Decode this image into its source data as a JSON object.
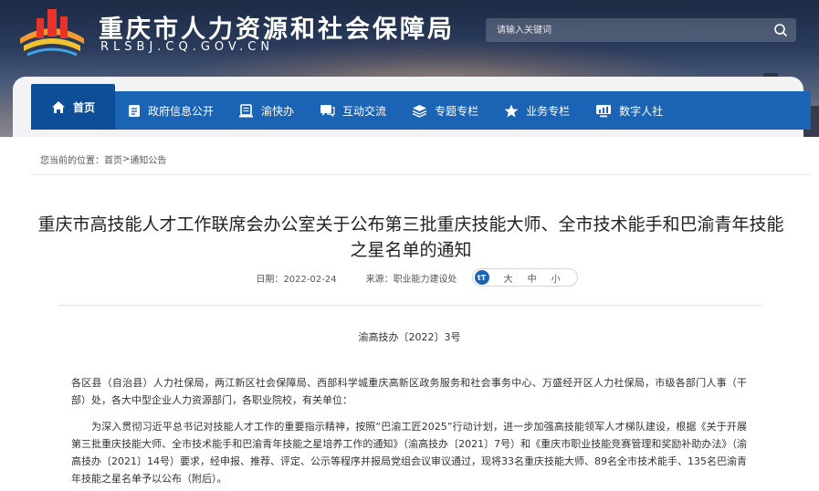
{
  "header": {
    "site_title": "重庆市人力资源和社会保障局",
    "site_subtitle": "RLSBJ.CQ.GOV.CN",
    "search_placeholder": "请输入关键词"
  },
  "nav": {
    "items": [
      {
        "label": "首页",
        "icon": "home-icon"
      },
      {
        "label": "政府信息公开",
        "icon": "document-icon"
      },
      {
        "label": "渝快办",
        "icon": "tablet-icon"
      },
      {
        "label": "互动交流",
        "icon": "chat-icon"
      },
      {
        "label": "专题专栏",
        "icon": "layers-icon"
      },
      {
        "label": "业务专栏",
        "icon": "star-icon"
      },
      {
        "label": "数字人社",
        "icon": "monitor-chart-icon"
      }
    ]
  },
  "breadcrumb": {
    "prefix": "您当前的位置：",
    "home": "首页",
    "separator": ">",
    "current": "通知公告"
  },
  "article": {
    "title": "重庆市高技能人才工作联席会办公室关于公布第三批重庆技能大师、全市技术能手和巴渝青年技能之星名单的通知",
    "date_label": "日期：",
    "date": "2022-02-24",
    "source_label": "来源：",
    "source": "职业能力建设处",
    "font_size_icon_text": "tT",
    "font_large": "大",
    "font_medium": "中",
    "font_small": "小",
    "doc_number": "渝高技办〔2022〕3号",
    "paragraph_1": "各区县（自治县）人力社保局，两江新区社会保障局、西部科学城重庆高新区政务服务和社会事务中心、万盛经开区人力社保局，市级各部门人事（干部）处，各大中型企业人力资源部门，各职业院校，有关单位：",
    "paragraph_2": "为深入贯彻习近平总书记对技能人才工作的重要指示精神，按照“巴渝工匠2025”行动计划，进一步加强高技能领军人才梯队建设，根据《关于开展第三批重庆技能大师、全市技术能手和巴渝青年技能之星培养工作的通知》（渝高技办〔2021〕7号）和《重庆市职业技能竞赛管理和奖励补助办法》（渝高技办〔2021〕14号）要求，经申报、推荐、评定、公示等程序并报局党组会议审议通过，现将33名重庆技能大师、89名全市技术能手、135名巴渝青年技能之星名单予以公布（附后）。"
  },
  "colors": {
    "nav_blue": "#1a63b5",
    "nav_active": "#0e4e98",
    "logo_red": "#e8322c",
    "logo_orange": "#f29a2e"
  }
}
